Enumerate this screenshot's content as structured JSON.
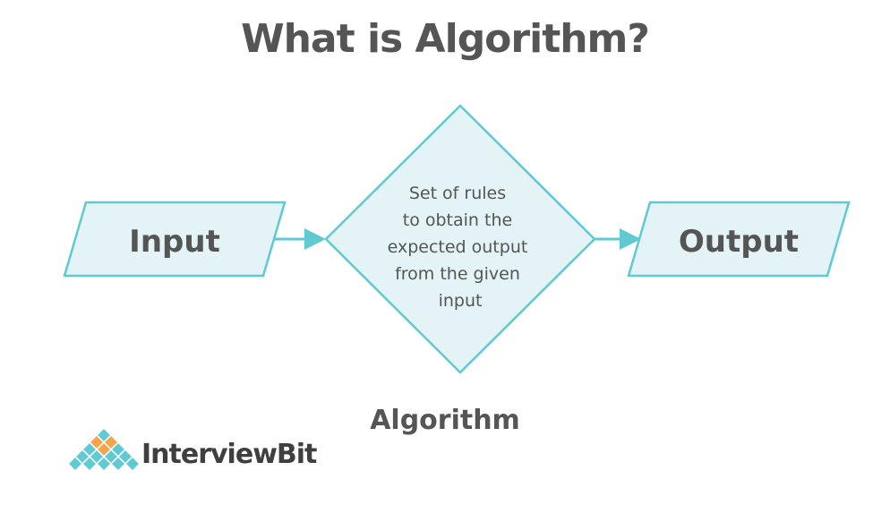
{
  "title": "What is Algorithm?",
  "nodes": {
    "input_label": "Input",
    "process_lines": [
      "Set of rules",
      "to obtain the",
      "expected output",
      "from the given",
      "input"
    ],
    "output_label": "Output"
  },
  "caption": "Algorithm",
  "brand": {
    "name": "InterviewBit",
    "logo_icon": "diamond-grid-logo"
  },
  "colors": {
    "shape_fill": "#e3f3f6",
    "shape_stroke": "#5fcad3",
    "arrow": "#5fcad3",
    "text": "#555555",
    "logo_teal": "#5fcad3",
    "logo_orange": "#f2a54a"
  }
}
